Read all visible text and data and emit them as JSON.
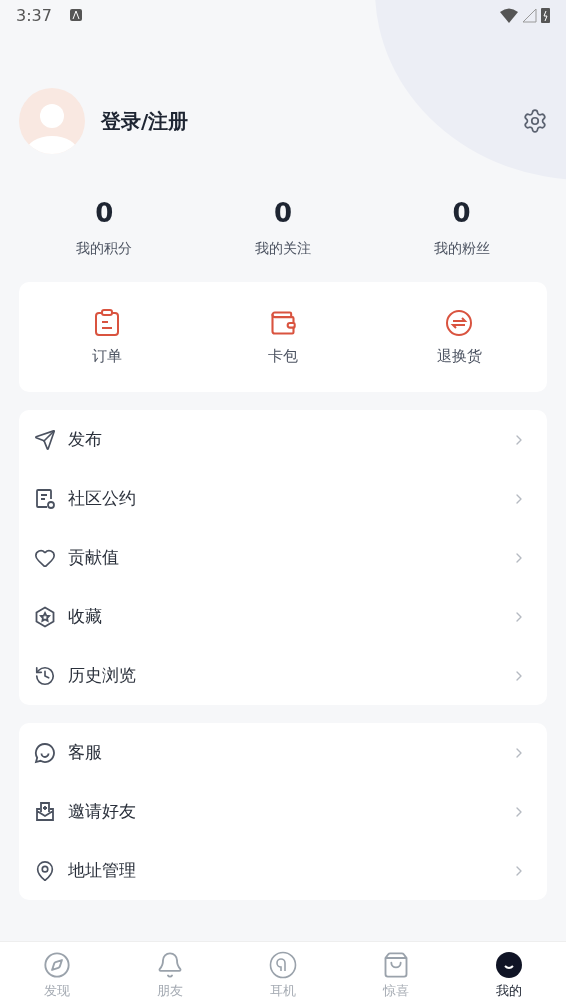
{
  "status_bar": {
    "time": "3:37"
  },
  "profile": {
    "name": "登录/注册"
  },
  "stats": [
    {
      "value": "0",
      "label": "我的积分"
    },
    {
      "value": "0",
      "label": "我的关注"
    },
    {
      "value": "0",
      "label": "我的粉丝"
    }
  ],
  "shortcuts": [
    {
      "kind": "order",
      "label": "订单"
    },
    {
      "kind": "wallet",
      "label": "卡包"
    },
    {
      "kind": "exchange",
      "label": "退换货"
    }
  ],
  "menu_groups": [
    [
      {
        "kind": "send",
        "label": "发布"
      },
      {
        "kind": "rules",
        "label": "社区公约"
      },
      {
        "kind": "heart",
        "label": "贡献值"
      },
      {
        "kind": "favorite",
        "label": "收藏"
      },
      {
        "kind": "history",
        "label": "历史浏览"
      }
    ],
    [
      {
        "kind": "service",
        "label": "客服"
      },
      {
        "kind": "invite",
        "label": "邀请好友"
      },
      {
        "kind": "address",
        "label": "地址管理"
      }
    ]
  ],
  "tab_bar": [
    {
      "kind": "discover",
      "label": "发现",
      "selected": false
    },
    {
      "kind": "friends",
      "label": "朋友",
      "selected": false
    },
    {
      "kind": "earphones",
      "label": "耳机",
      "selected": false
    },
    {
      "kind": "surprise",
      "label": "惊喜",
      "selected": false
    },
    {
      "kind": "me",
      "label": "我的",
      "selected": true
    }
  ]
}
